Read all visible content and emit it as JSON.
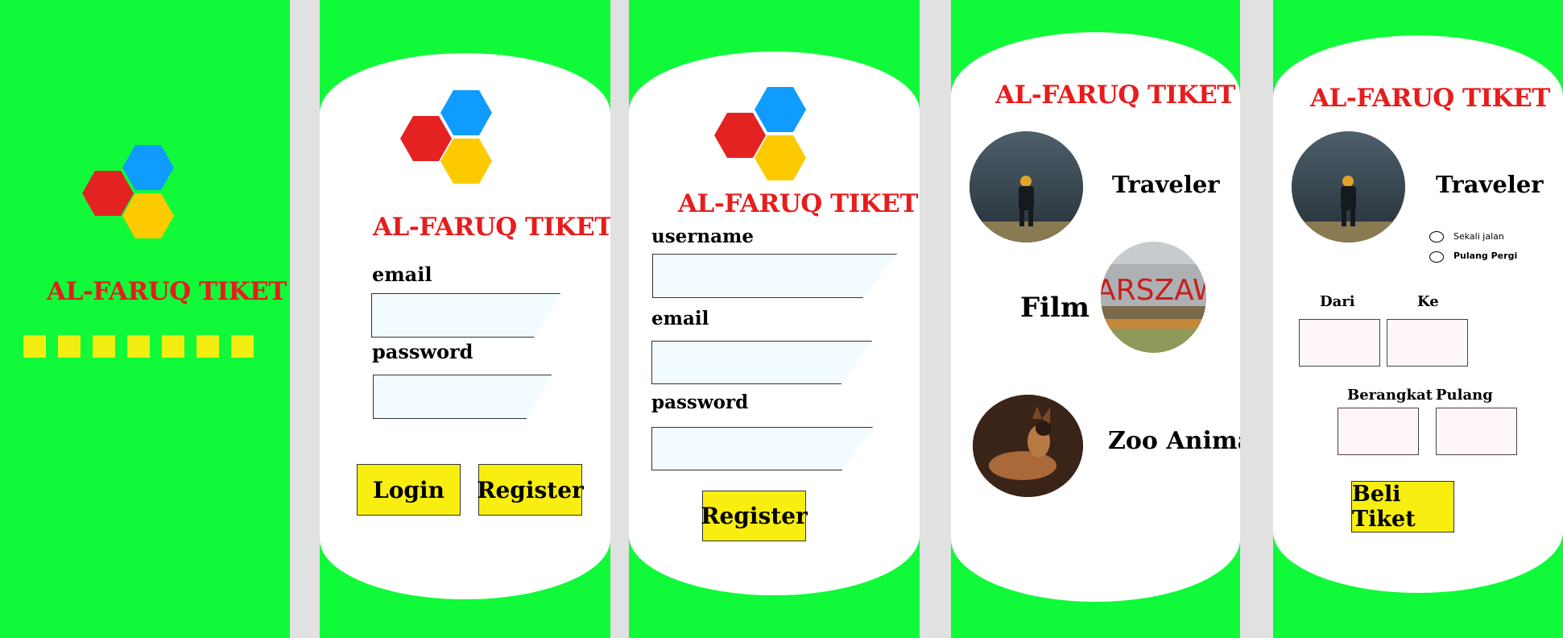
{
  "brand": {
    "name": "AL-FARUQ TIKET",
    "color": "#e71c1c",
    "logo_colors": [
      "#e52222",
      "#109cff",
      "#fdca00"
    ]
  },
  "splash": {
    "loading_squares": 7
  },
  "login": {
    "email_label": "email",
    "password_label": "password",
    "login_button": "Login",
    "register_button": "Register"
  },
  "register": {
    "username_label": "username",
    "email_label": "email",
    "password_label": "password",
    "register_button": "Register"
  },
  "categories": {
    "items": [
      {
        "label": "Traveler",
        "image": "traveler-photo"
      },
      {
        "label": "Film",
        "image": "warszawa-photo"
      },
      {
        "label": "Zoo Animals",
        "image": "dog-photo"
      }
    ]
  },
  "booking": {
    "category": "Traveler",
    "trip_options": [
      "Sekali jalan",
      "Pulang Pergi"
    ],
    "from_label": "Dari",
    "to_label": "Ke",
    "depart_label": "Berangkat",
    "return_label": "Pulang",
    "buy_button": "Beli Tiket"
  },
  "colors": {
    "background": "#10fa3a",
    "card": "#ffffff",
    "button": "#f8ee10",
    "gap": "#e1e1e1"
  }
}
